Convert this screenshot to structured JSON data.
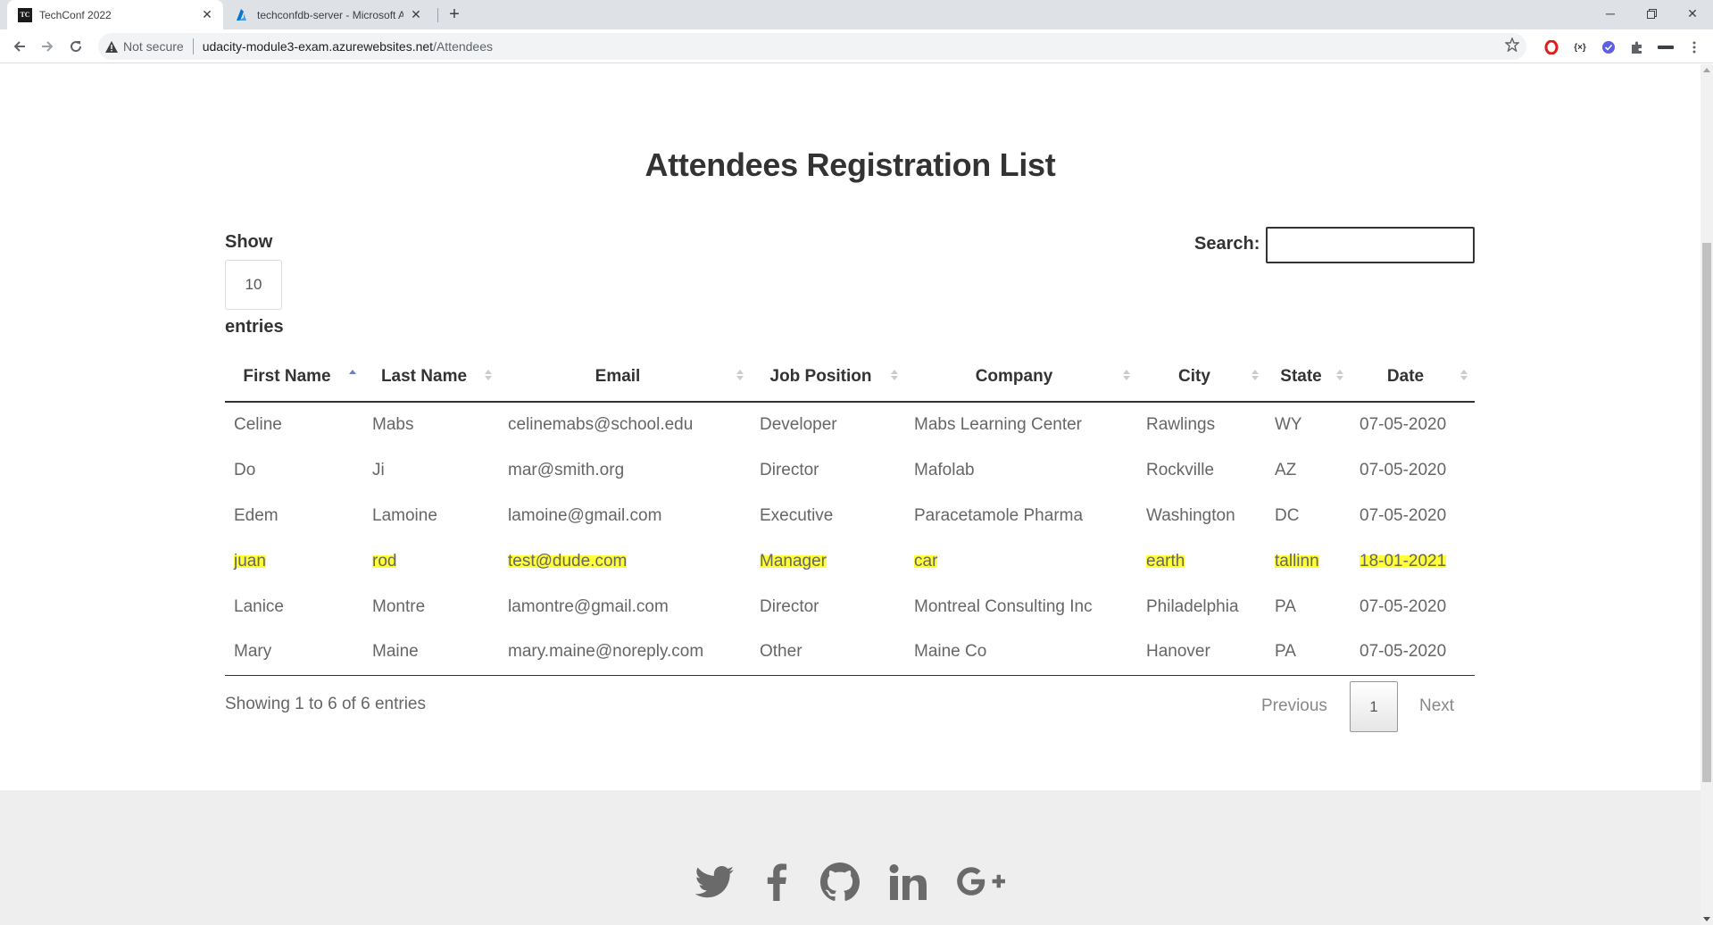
{
  "browser": {
    "tabs": [
      {
        "title": "TechConf 2022",
        "favicon_text": "TC",
        "active": true
      },
      {
        "title": "techconfdb-server - Microsoft Az",
        "active": false
      }
    ],
    "security_label": "Not secure",
    "url_host": "udacity-module3-exam.azurewebsites.net",
    "url_path": "/Attendees"
  },
  "page": {
    "title": "Attendees Registration List",
    "length": {
      "show_label": "Show",
      "value": "10",
      "entries_label": "entries"
    },
    "search": {
      "label": "Search:",
      "value": ""
    },
    "table": {
      "columns": [
        "First Name",
        "Last Name",
        "Email",
        "Job Position",
        "Company",
        "City",
        "State",
        "Date"
      ],
      "sorted_column": "First Name",
      "sort_direction": "ascending",
      "rows": [
        [
          "Celine",
          "Mabs",
          "celinemabs@school.edu",
          "Developer",
          "Mabs Learning Center",
          "Rawlings",
          "WY",
          "07-05-2020"
        ],
        [
          "Do",
          "Ji",
          "mar@smith.org",
          "Director",
          "Mafolab",
          "Rockville",
          "AZ",
          "07-05-2020"
        ],
        [
          "Edem",
          "Lamoine",
          "lamoine@gmail.com",
          "Executive",
          "Paracetamole Pharma",
          "Washington",
          "DC",
          "07-05-2020"
        ],
        [
          "juan",
          "rod",
          "test@dude.com",
          "Manager",
          "car",
          "earth",
          "tallinn",
          "18-01-2021"
        ],
        [
          "Lanice",
          "Montre",
          "lamontre@gmail.com",
          "Director",
          "Montreal Consulting Inc",
          "Philadelphia",
          "PA",
          "07-05-2020"
        ],
        [
          "Mary",
          "Maine",
          "mary.maine@noreply.com",
          "Other",
          "Maine Co",
          "Hanover",
          "PA",
          "07-05-2020"
        ]
      ],
      "highlighted_row_index": 3,
      "highlight_color": "#ffff3a"
    },
    "info": "Showing 1 to 6 of 6 entries",
    "pagination": {
      "previous": "Previous",
      "current": "1",
      "next": "Next"
    }
  },
  "footer": {
    "social_icons": [
      "twitter-icon",
      "facebook-icon",
      "github-icon",
      "linkedin-icon",
      "google-plus-icon"
    ]
  }
}
